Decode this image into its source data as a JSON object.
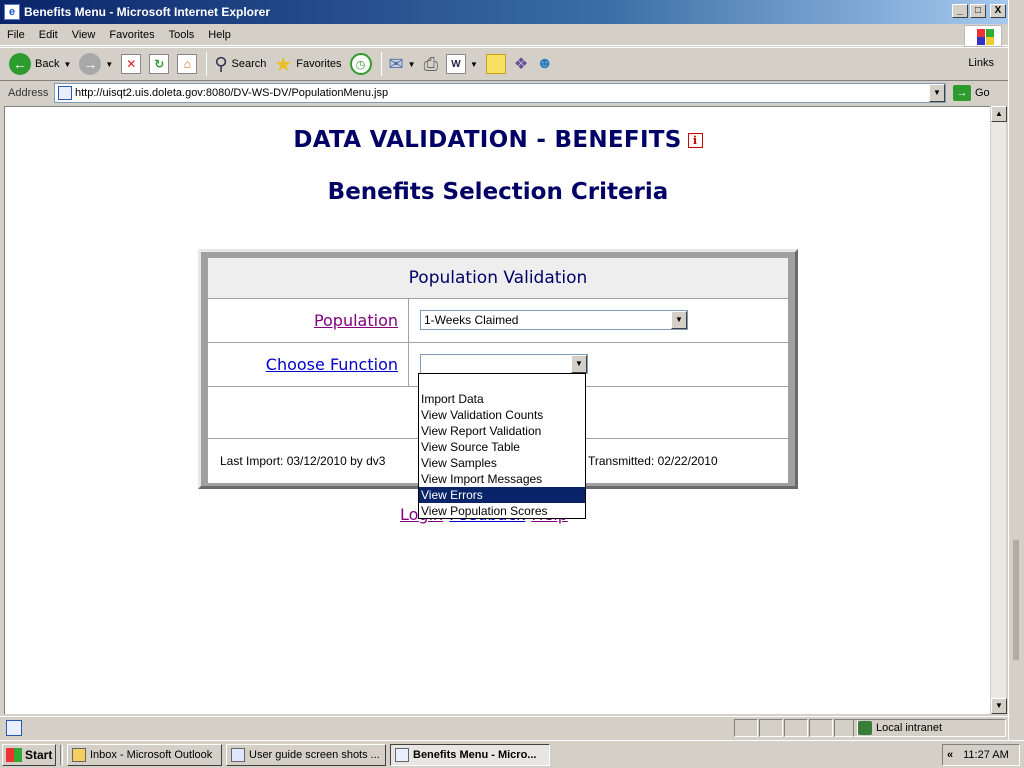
{
  "window": {
    "title": "Benefits Menu - Microsoft Internet Explorer",
    "minimize": "_",
    "maximize": "□",
    "close": "X"
  },
  "menubar": {
    "items": [
      "File",
      "Edit",
      "View",
      "Favorites",
      "Tools",
      "Help"
    ]
  },
  "toolbar": {
    "back_label": "Back",
    "search_label": "Search",
    "favorites_label": "Favorites",
    "links_label": "Links"
  },
  "addressbar": {
    "label": "Address",
    "url": "http://uisqt2.uis.doleta.gov:8080/DV-WS-DV/PopulationMenu.jsp",
    "go_label": "Go"
  },
  "page": {
    "heading": "DATA VALIDATION - BENEFITS",
    "info_icon_glyph": "i",
    "subheading": "Benefits Selection Criteria",
    "panel": {
      "title": "Population Validation",
      "population_label": "Population",
      "population_value": "1-Weeks Claimed",
      "function_label": "Choose Function",
      "function_value": "",
      "last_import": "Last Import: 03/12/2010 by dv3",
      "transmitted": "Transmitted: 02/22/2010"
    },
    "function_options": [
      "Import Data",
      "View Validation Counts",
      "View Report Validation",
      "View Source Table",
      "View Samples",
      "View Import Messages",
      "View Errors",
      "View Population Scores"
    ],
    "highlighted_option_index": 6,
    "bottom_links": {
      "login": "Login",
      "feedback": "Feedback",
      "help": "Help"
    }
  },
  "statusbar": {
    "zone": "Local intranet"
  },
  "taskbar": {
    "start": "Start",
    "tasks": [
      {
        "label": "Inbox - Microsoft Outlook",
        "active": false
      },
      {
        "label": "User guide screen shots ...",
        "active": false
      },
      {
        "label": "Benefits Menu - Micro...",
        "active": true
      }
    ],
    "tray_chevron": "«",
    "clock": "11:27 AM"
  },
  "colors": {
    "heading": "#000066",
    "link_visited": "#800080",
    "link": "#0000cc",
    "selection": "#0a246a"
  }
}
